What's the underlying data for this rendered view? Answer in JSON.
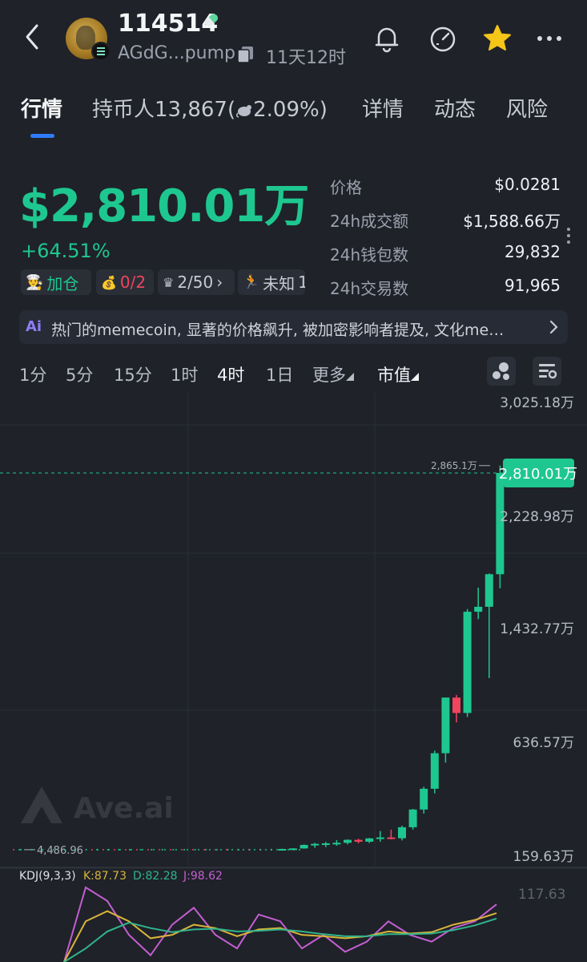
{
  "header": {
    "title": "114514",
    "address": "AGdG...pump",
    "age": "11天12时"
  },
  "tabs": [
    {
      "label": "行情",
      "active": true
    },
    {
      "label": "持币人13,867(",
      "suffix": "2.09%)"
    },
    {
      "label": "详情"
    },
    {
      "label": "动态"
    },
    {
      "label": "风险"
    }
  ],
  "price_block": {
    "market_cap": "$2,810.01万",
    "change": "+64.51%",
    "chips": {
      "add": "加仓",
      "bag": "0/2",
      "crown": "2/50",
      "runner": "未知",
      "runner_extra": "1"
    },
    "stats": [
      {
        "label": "价格",
        "value": "$0.0281"
      },
      {
        "label": "24h成交额",
        "value": "$1,588.66万"
      },
      {
        "label": "24h钱包数",
        "value": "29,832"
      },
      {
        "label": "24h交易数",
        "value": "91,965"
      }
    ]
  },
  "ai_banner": {
    "icon": "Ai",
    "text": "热门的memecoin, 显著的价格飙升, 被加密影响者提及, 文化me…"
  },
  "intervals": [
    {
      "label": "1分"
    },
    {
      "label": "5分"
    },
    {
      "label": "15分"
    },
    {
      "label": "1时"
    },
    {
      "label": "4时",
      "active": true
    },
    {
      "label": "1日"
    },
    {
      "label": "更多"
    },
    {
      "label": "市值",
      "active": true
    }
  ],
  "colors": {
    "up": "#1ec78f",
    "down": "#f0455d",
    "accent": "#2f7cf6",
    "star": "#f5c518",
    "k_line": "#d9b43a",
    "d_line": "#2fb58d",
    "j_line": "#c45ed1"
  },
  "chart_data": {
    "type": "candlestick",
    "y_axis_labels": [
      "3,025.18万",
      "2,228.98万",
      "1,432.77万",
      "636.57万",
      "159.63万"
    ],
    "current_value_label": "2,810.01万",
    "high_marker": "2,865.1万",
    "low_marker": "4,486.96",
    "watermark": "Ave.ai",
    "ylim_wan": [
      0,
      3300
    ],
    "ohlc_wan": [
      [
        0.45,
        0.45,
        0.45,
        0.45
      ],
      [
        0.45,
        0.45,
        0.45,
        0.45
      ],
      [
        0.45,
        0.45,
        0.45,
        0.45
      ],
      [
        0.45,
        0.45,
        0.45,
        0.45
      ],
      [
        0.45,
        0.45,
        0.45,
        0.45
      ],
      [
        0.45,
        0.45,
        0.45,
        0.45
      ],
      [
        0.45,
        0.45,
        0.45,
        0.45
      ],
      [
        0.45,
        0.45,
        0.45,
        0.45
      ],
      [
        0.45,
        0.45,
        0.45,
        0.45
      ],
      [
        0.45,
        0.45,
        0.45,
        0.45
      ],
      [
        0.45,
        0.45,
        0.45,
        0.45
      ],
      [
        0.45,
        0.45,
        0.45,
        0.45
      ],
      [
        0.45,
        0.45,
        0.45,
        0.45
      ],
      [
        0.45,
        0.45,
        0.45,
        0.45
      ],
      [
        0.45,
        0.45,
        0.45,
        0.45
      ],
      [
        0.45,
        0.45,
        0.45,
        0.45
      ],
      [
        0.45,
        0.45,
        0.45,
        0.45
      ],
      [
        0.45,
        0.45,
        0.45,
        0.45
      ],
      [
        0.45,
        0.45,
        0.45,
        0.45
      ],
      [
        0.45,
        0.45,
        0.45,
        0.45
      ],
      [
        0.45,
        0.45,
        0.45,
        0.45
      ],
      [
        0.45,
        0.45,
        0.45,
        0.45
      ],
      [
        0.45,
        0.45,
        0.45,
        0.45
      ],
      [
        0.45,
        0.45,
        0.45,
        0.45
      ],
      [
        0.45,
        8,
        0.45,
        6
      ],
      [
        6,
        12,
        3,
        10
      ],
      [
        10,
        40,
        8,
        36
      ],
      [
        36,
        52,
        14,
        44
      ],
      [
        44,
        58,
        20,
        48
      ],
      [
        48,
        72,
        30,
        52
      ],
      [
        52,
        78,
        40,
        74
      ],
      [
        74,
        82,
        48,
        60
      ],
      [
        60,
        88,
        50,
        85
      ],
      [
        85,
        140,
        60,
        92
      ],
      [
        92,
        150,
        78,
        86
      ],
      [
        86,
        180,
        70,
        168
      ],
      [
        168,
        305,
        150,
        300
      ],
      [
        300,
        470,
        270,
        455
      ],
      [
        455,
        740,
        420,
        720
      ],
      [
        720,
        1135,
        650,
        1135
      ],
      [
        1135,
        1155,
        950,
        1020
      ],
      [
        1020,
        1795,
        990,
        1775
      ],
      [
        1775,
        1955,
        1720,
        1812
      ],
      [
        1812,
        2060,
        1280,
        2055
      ],
      [
        2055,
        2865,
        1950,
        2810
      ]
    ]
  },
  "kdj": {
    "label": "KDJ(9,3,3)",
    "k": "K:87.73",
    "d": "D:82.28",
    "j": "J:98.62",
    "axis_label": "117.63"
  }
}
